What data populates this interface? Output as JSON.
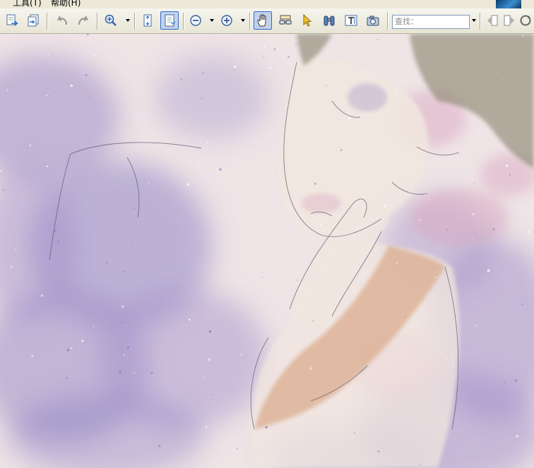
{
  "menu": {
    "tail_label": "）",
    "tools_label": "工具(T)",
    "help_label": "帮助(H)"
  },
  "toolbar": {
    "buttons": [
      {
        "name": "page-extract-button",
        "icon": "page-arrow-icon"
      },
      {
        "name": "page-insert-button",
        "icon": "page-stack-icon"
      },
      {
        "name": "undo-button",
        "icon": "undo-arrow-icon"
      },
      {
        "name": "redo-button",
        "icon": "redo-arrow-icon"
      },
      {
        "name": "zoom-tool-button",
        "icon": "magnifier-plus-icon"
      },
      {
        "name": "fit-page-button",
        "icon": "fit-page-icon"
      },
      {
        "name": "actual-size-button",
        "icon": "actual-size-icon",
        "active": true
      },
      {
        "name": "zoom-out-button",
        "icon": "minus-circle-icon"
      },
      {
        "name": "zoom-in-button",
        "icon": "plus-circle-icon"
      },
      {
        "name": "hand-tool-button",
        "icon": "hand-icon",
        "active": true
      },
      {
        "name": "loupe-tool-button",
        "icon": "glasses-icon"
      },
      {
        "name": "select-tool-button",
        "icon": "arrow-cursor-icon"
      },
      {
        "name": "find-button",
        "icon": "binoculars-icon"
      },
      {
        "name": "text-select-button",
        "icon": "text-select-icon"
      },
      {
        "name": "snapshot-button",
        "icon": "camera-icon"
      },
      {
        "name": "previous-page-button",
        "icon": "prev-page-icon"
      },
      {
        "name": "next-page-button",
        "icon": "next-page-icon"
      },
      {
        "name": "refresh-button",
        "icon": "refresh-icon"
      }
    ]
  },
  "search": {
    "placeholder": "查找："
  },
  "document": {
    "content": "painting of a sleeping woman among lavender peonies",
    "colors": {
      "paper": "#efe4e6",
      "lavender": "#9f8ec9",
      "violet": "#7f73c0",
      "rose": "#d9a3be",
      "skin": "#f1e6df",
      "hair": "#7e7a60",
      "dress": "#d9a988"
    }
  }
}
